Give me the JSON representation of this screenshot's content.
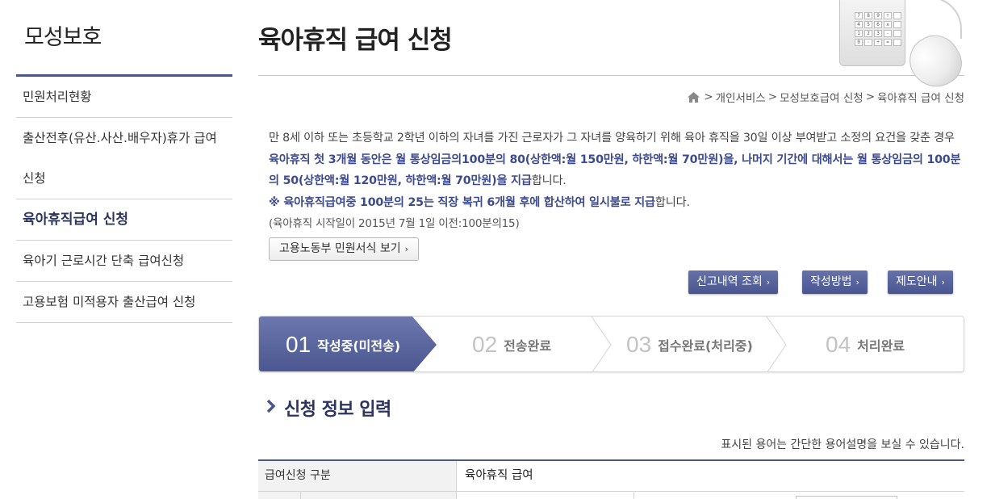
{
  "sidebar": {
    "title": "모성보호",
    "items": [
      {
        "label": "민원처리현황"
      },
      {
        "label": "출산전후(유산.사산.배우자)휴가 급여"
      },
      {
        "label": "신청"
      },
      {
        "label": "육아휴직급여 신청"
      },
      {
        "label": "육아기 근로시간 단축 급여신청"
      },
      {
        "label": "고용보험 미적용자 출산급여 신청"
      }
    ]
  },
  "header": {
    "title": "육아휴직 급여 신청"
  },
  "breadcrumb": {
    "home_icon": "home-icon",
    "items": [
      "개인서비스",
      "모성보호급여 신청",
      "육아휴직 급여 신청"
    ],
    "sep": ">"
  },
  "intro": {
    "p1": "만 8세 이하 또는 초등학교 2학년 이하의 자녀를 가진 근로자가 그 자녀를 양육하기 위해 육아 휴직을 30일 이상 부여받고 소정의 요건을 갖춘 경우 ",
    "p1_hl": "육아휴직 첫 3개월 동안은 월 통상임금의100분의 80(상한액:월 150만원, 하한액:월 70만원)을, 나머지 기간에 대해서는 월 통상임금의 100분의 50(상한액:월 120만원, 하한액:월 70만원)을 지급",
    "p1_end": "합니다.",
    "p2_hl": "※ 육아휴직급여중 100분의 25는 직장 복귀 6개월 후에 합산하여 일시불로 지급",
    "p2_end": "합니다.",
    "p3": "(육아휴직 시작일이 2015년 7월 1일 이전:100분의15)"
  },
  "buttons": {
    "form_view": "고용노동부 민원서식 보기",
    "history": "신고내역 조회",
    "howto": "작성방법",
    "guide": "제도안내",
    "arrow": "›"
  },
  "steps": [
    {
      "num": "01",
      "label": "작성중(미전송)"
    },
    {
      "num": "02",
      "label": "전송완료"
    },
    {
      "num": "03",
      "label": "접수완료(처리중)"
    },
    {
      "num": "04",
      "label": "처리완료"
    }
  ],
  "section": {
    "title": "신청 정보 입력",
    "hint": "표시된 용어는 간단한 용어설명을 보실 수 있습니다."
  },
  "table": {
    "row1_label": "급여신청 구분",
    "row1_value": "육아휴직 급여"
  },
  "calculator_keys": [
    "7",
    "8",
    "9",
    "÷",
    "",
    "4",
    "5",
    "6",
    "x",
    "",
    "1",
    "2",
    "3",
    "-",
    "",
    "0",
    "·",
    "+",
    "=",
    ""
  ],
  "colors": {
    "accent": "#4b5689",
    "highlight_text": "#3d4a8c"
  }
}
